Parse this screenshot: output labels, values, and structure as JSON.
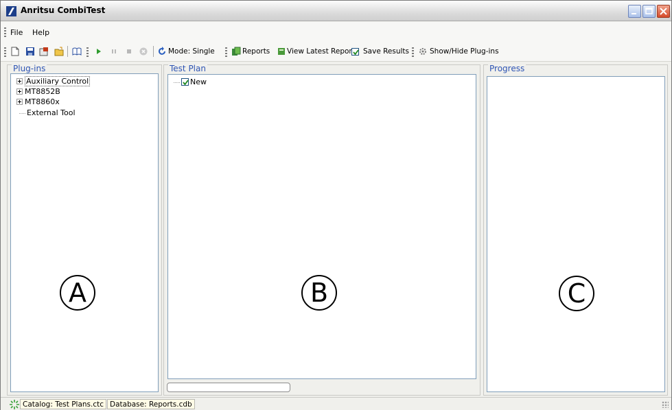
{
  "window": {
    "title": "Anritsu CombiTest",
    "logo_icon": "anritsu-logo",
    "controls": [
      "minimize-icon",
      "maximize-icon",
      "close-icon"
    ]
  },
  "menu": {
    "items": [
      {
        "label": "File",
        "mnemonic": "F"
      },
      {
        "label": "Help",
        "mnemonic": "H"
      }
    ]
  },
  "toolbar": {
    "file_icons": [
      "new-icon",
      "save-icon",
      "properties-icon",
      "open-folder-icon",
      "book-icon"
    ],
    "run_icons": [
      "play-icon",
      "pause-icon",
      "stop-icon",
      "abort-icon"
    ],
    "mode_label": "Mode: Single",
    "reports_label": "Reports",
    "view_latest_label": "View Latest Report",
    "save_results_label": "Save Results",
    "save_results_checked": true,
    "plugins_toggle_label": "Show/Hide Plug-ins"
  },
  "plugins_panel": {
    "title": "Plug-ins",
    "tree": [
      {
        "label": "Auxiliary Control",
        "expandable": true,
        "selected": true
      },
      {
        "label": "MT8852B",
        "expandable": true,
        "selected": false
      },
      {
        "label": "MT8860x",
        "expandable": true,
        "selected": false
      },
      {
        "label": "External Tool",
        "expandable": false,
        "selected": false
      }
    ],
    "marker": "A"
  },
  "test_plan_panel": {
    "title": "Test Plan",
    "tree": [
      {
        "label": "New",
        "checked": true
      }
    ],
    "marker": "B"
  },
  "progress_panel": {
    "title": "Progress",
    "marker": "C"
  },
  "statusbar": {
    "catalog": "Catalog: Test Plans.ctc",
    "database": "Database: Reports.cdb"
  },
  "colors": {
    "panel_title": "#2f55b4",
    "inner_border": "#7f9db9",
    "play_green": "#2e9b2e",
    "logo_blue": "#1c3e8a"
  }
}
